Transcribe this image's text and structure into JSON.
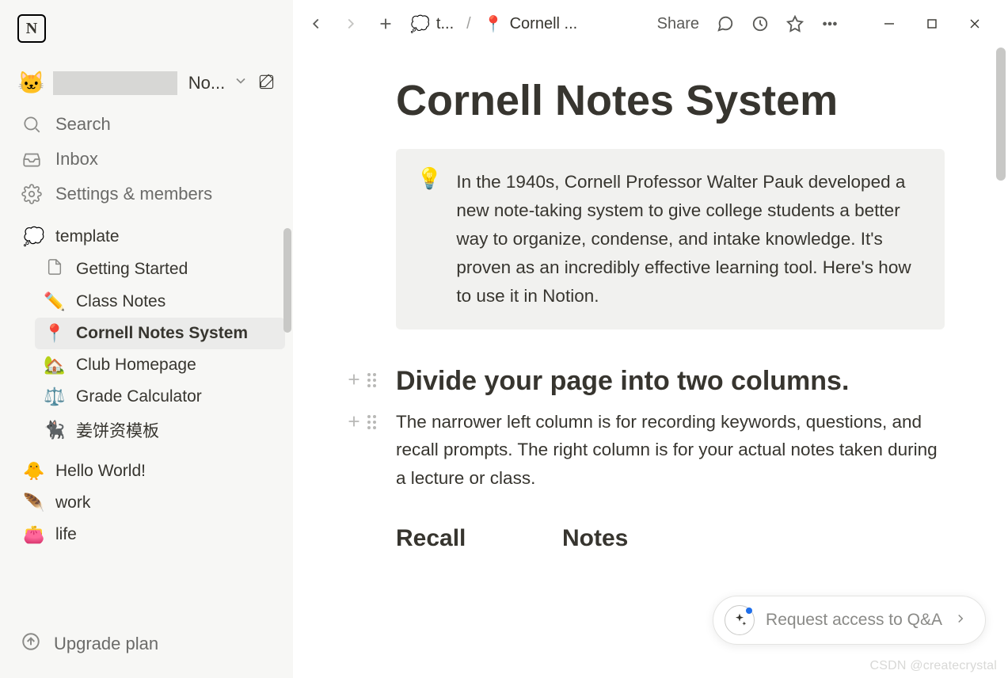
{
  "workspace": {
    "emoji": "🐱",
    "name_trunc": "No..."
  },
  "nav": {
    "search": "Search",
    "inbox": "Inbox",
    "settings": "Settings & members"
  },
  "tree": {
    "template": {
      "emoji": "💭",
      "label": "template"
    },
    "children": [
      {
        "icon": "doc",
        "label": "Getting Started"
      },
      {
        "emoji": "✏️",
        "label": "Class Notes"
      },
      {
        "emoji": "📍",
        "label": "Cornell Notes System",
        "active": true
      },
      {
        "emoji": "🏡",
        "label": "Club Homepage"
      },
      {
        "emoji": "⚖️",
        "label": "Grade Calculator"
      },
      {
        "emoji": "🐈‍⬛",
        "label": "姜饼资模板"
      }
    ],
    "top_pages": [
      {
        "emoji": "🐥",
        "label": "Hello World!"
      },
      {
        "emoji": "🪶",
        "label": "work"
      },
      {
        "emoji": "👛",
        "label": "life"
      }
    ]
  },
  "footer": {
    "upgrade": "Upgrade plan"
  },
  "topbar": {
    "crumb1_emoji": "💭",
    "crumb1_label": "t...",
    "crumb2_emoji": "📍",
    "crumb2_label": "Cornell ...",
    "share": "Share"
  },
  "page": {
    "title": "Cornell Notes System",
    "callout_emoji": "💡",
    "callout_text": "In the 1940s, Cornell Professor Walter Pauk developed a new note-taking system to give college students a better way to organize, condense, and intake knowledge. It's proven as an incredibly effective learning tool. Here's how to use it in Notion.",
    "h2": "Divide your page into two columns.",
    "para": "The narrower left column is for recording keywords, questions, and recall prompts. The right column is for your actual notes taken during a lecture or class.",
    "col_recall": "Recall",
    "col_notes": "Notes"
  },
  "qa": {
    "label": "Request access to Q&A"
  },
  "watermark": "CSDN @createcrystal"
}
